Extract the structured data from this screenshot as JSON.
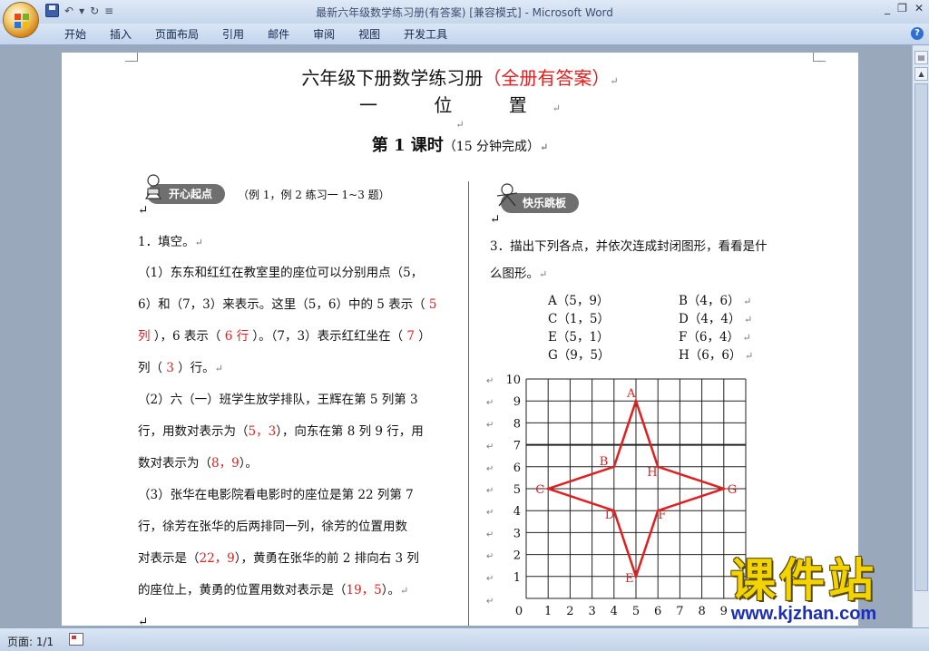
{
  "window": {
    "title": "最新六年级数学练习册(有答案) [兼容模式] - Microsoft Word"
  },
  "ribbon": {
    "tabs": [
      "开始",
      "插入",
      "页面布局",
      "引用",
      "邮件",
      "审阅",
      "视图",
      "开发工具"
    ]
  },
  "doc": {
    "title_main": "六年级下册数学练习册",
    "title_red": "（全册有答案）",
    "unit_title": "一 位 置",
    "lesson_title": "第 1 课时",
    "lesson_sub": "（15 分钟完成）",
    "para_mark": "↵",
    "left": {
      "badge": "开心起点",
      "badge_note": "（例 1，例 2  练习一 1~3 题）",
      "q1_title": "1．填空。",
      "lines": [
        [
          {
            "t": "（1）东东和红红在教室里的座位可以分别用点（5，"
          }
        ],
        [
          {
            "t": "6）和（7，3）来表示。这里（5，6）中的 5 表示（ "
          },
          {
            "t": "5",
            "red": true
          }
        ],
        [
          {
            "t": "列",
            "red": true
          },
          {
            "t": " ），6 表示（ "
          },
          {
            "t": "6 行",
            "red": true
          },
          {
            "t": " ）。（7，3）表示红红坐在（  "
          },
          {
            "t": "7",
            "red": true
          },
          {
            "t": "  ）"
          }
        ],
        [
          {
            "t": "列（  "
          },
          {
            "t": "3",
            "red": true
          },
          {
            "t": "  ）行。"
          }
        ],
        [
          {
            "t": "（2）六（一）班学生放学排队，王辉在第 5 列第 3"
          }
        ],
        [
          {
            "t": "行，用数对表示为（"
          },
          {
            "t": "5，3",
            "red": true
          },
          {
            "t": "），向东在第 8 列 9 行，用"
          }
        ],
        [
          {
            "t": "数对表示为（"
          },
          {
            "t": "8，9",
            "red": true
          },
          {
            "t": "）。"
          }
        ],
        [
          {
            "t": "（3）张华在电影院看电影时的座位是第  22  列第  7"
          }
        ],
        [
          {
            "t": "行，徐芳在张华的后两排同一列，徐芳的位置用数"
          }
        ],
        [
          {
            "t": "对表示是（"
          },
          {
            "t": "22，9",
            "red": true
          },
          {
            "t": "），黄勇在张华的前 2 排向右 3 列"
          }
        ],
        [
          {
            "t": "的座位上，黄勇的位置用数对表示是（"
          },
          {
            "t": "19，5",
            "red": true
          },
          {
            "t": "）。"
          }
        ]
      ]
    },
    "right": {
      "badge": "快乐跳板",
      "q3_line1": "3．描出下列各点，并依次连成封闭图形，看看是什",
      "q3_line2": "么图形。",
      "points_text": [
        [
          "A（5，9）",
          "B（4，6）"
        ],
        [
          "C（1，5）",
          "D（4，4）"
        ],
        [
          "E（5，1）",
          "F（6，4）"
        ],
        [
          "G（9，5）",
          "H（6，6）"
        ]
      ]
    }
  },
  "chart_data": {
    "type": "scatter",
    "title": "",
    "xlabel": "",
    "ylabel": "",
    "xlim": [
      0,
      10
    ],
    "ylim": [
      0,
      10
    ],
    "x_ticks": [
      "0",
      "1",
      "2",
      "3",
      "4",
      "5",
      "6",
      "7",
      "8",
      "9"
    ],
    "y_ticks": [
      "1",
      "2",
      "3",
      "4",
      "5",
      "6",
      "7",
      "8",
      "9",
      "10"
    ],
    "grid": true,
    "closed_path": true,
    "series": [
      {
        "color": "#e02020",
        "points": [
          {
            "label": "A",
            "x": 5,
            "y": 9
          },
          {
            "label": "B",
            "x": 4,
            "y": 6
          },
          {
            "label": "C",
            "x": 1,
            "y": 5
          },
          {
            "label": "D",
            "x": 4,
            "y": 4
          },
          {
            "label": "E",
            "x": 5,
            "y": 1
          },
          {
            "label": "F",
            "x": 6,
            "y": 4
          },
          {
            "label": "G",
            "x": 9,
            "y": 5
          },
          {
            "label": "H",
            "x": 6,
            "y": 6
          }
        ]
      }
    ]
  },
  "status": {
    "page_label": "页面: 1/1"
  },
  "watermark": {
    "big": "课件站",
    "url": "www.kjzhan.com"
  }
}
